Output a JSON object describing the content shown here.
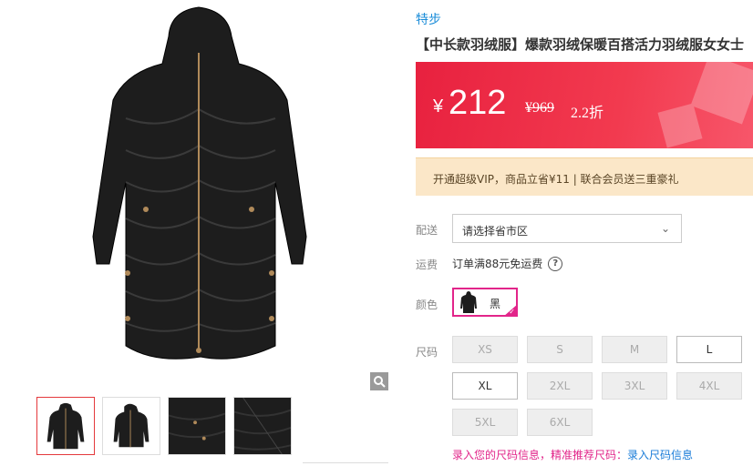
{
  "brand": "特步",
  "title": "【中长款羽绒服】爆款羽绒保暖百搭活力羽绒服女女士",
  "price": {
    "currency": "¥",
    "current": "212",
    "original": "¥969",
    "discount": "2.2折",
    "accent": "#e8213f"
  },
  "vip_text": "开通超级VIP，商品立省¥11 | 联合会员送三重豪礼",
  "delivery": {
    "label": "配送",
    "placeholder": "请选择省市区"
  },
  "shipping": {
    "label": "运费",
    "text": "订单满88元免运费"
  },
  "color": {
    "label": "颜色",
    "option": "黑"
  },
  "sizes": {
    "label": "尺码",
    "options": [
      {
        "label": "XS",
        "available": false
      },
      {
        "label": "S",
        "available": false
      },
      {
        "label": "M",
        "available": false
      },
      {
        "label": "L",
        "available": true
      },
      {
        "label": "XL",
        "available": true
      },
      {
        "label": "2XL",
        "available": false
      },
      {
        "label": "3XL",
        "available": false
      },
      {
        "label": "4XL",
        "available": false
      },
      {
        "label": "5XL",
        "available": false
      },
      {
        "label": "6XL",
        "available": false
      }
    ]
  },
  "size_tip": {
    "text": "录入您的尺码信息，精准推荐尺码：",
    "link": "录入尺码信息"
  },
  "icons": [
    "zoom-icon",
    "chevron-down-icon",
    "question-icon",
    "check-icon"
  ]
}
